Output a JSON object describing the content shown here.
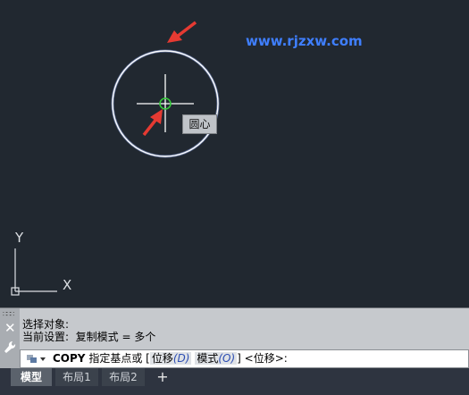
{
  "watermark": "www.rjzxw.com",
  "tooltip": "圆心",
  "ucs": {
    "y_label": "Y",
    "x_label": "X"
  },
  "command_history": [
    "选择对象:",
    "当前设置:  复制模式 = 多个"
  ],
  "command_line": {
    "command": "COPY",
    "prompt": "指定基点或",
    "bracket_open": "[",
    "option1_label": "位移",
    "option1_key": "(D)",
    "option2_label": "模式",
    "option2_key": "(O)",
    "bracket_close": "]",
    "default": "<位移>:"
  },
  "tabs": [
    "模型",
    "布局1",
    "布局2"
  ],
  "tab_add": "+",
  "colors": {
    "canvas_bg": "#212830",
    "circle": "#ffffff",
    "crosshair": "#ffffff",
    "osnap": "#34c83a",
    "arrow": "#e53a32",
    "watermark": "#3f7fff"
  }
}
